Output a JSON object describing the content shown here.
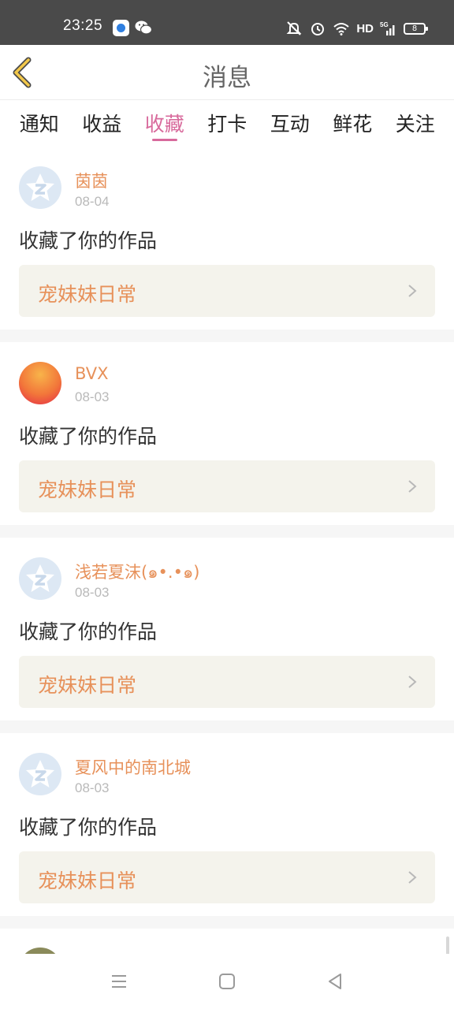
{
  "status_bar": {
    "time": "23:25",
    "network": "HD",
    "battery": "8",
    "icons": [
      "app-notification-icon",
      "wechat-icon",
      "mute-icon",
      "alarm-icon",
      "wifi-icon",
      "signal-5g-icon",
      "battery-icon"
    ]
  },
  "header": {
    "title": "消息",
    "back_icon": "chevron-left-icon"
  },
  "tabs": [
    {
      "label": "通知",
      "active": false
    },
    {
      "label": "收益",
      "active": false
    },
    {
      "label": "收藏",
      "active": true
    },
    {
      "label": "打卡",
      "active": false
    },
    {
      "label": "互动",
      "active": false
    },
    {
      "label": "鲜花",
      "active": false
    },
    {
      "label": "关注",
      "active": false
    }
  ],
  "feed": {
    "items": [
      {
        "user": "茵茵",
        "date": "08-04",
        "action": "收藏了你的作品",
        "work": "宠妹妹日常",
        "avatar": "default-avatar"
      },
      {
        "user": "BVX",
        "date": "08-03",
        "action": "收藏了你的作品",
        "work": "宠妹妹日常",
        "avatar": "sunset-avatar"
      },
      {
        "user": "浅若夏沫(๑•.•๑)",
        "date": "08-03",
        "action": "收藏了你的作品",
        "work": "宠妹妹日常",
        "avatar": "default-avatar"
      },
      {
        "user": "夏风中的南北城",
        "date": "08-03",
        "action": "收藏了你的作品",
        "work": "宠妹妹日常",
        "avatar": "default-avatar"
      }
    ]
  },
  "nav_bar": {
    "icons": [
      "menu-icon",
      "home-icon",
      "back-icon"
    ]
  },
  "colors": {
    "accent": "#d86a9c",
    "name_orange": "#e7915a",
    "status_bar": "#4a4a4a",
    "card_link_bg": "#f4f3ec"
  }
}
